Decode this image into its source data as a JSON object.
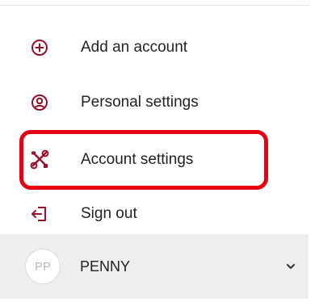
{
  "menu": {
    "items": [
      {
        "label": "Add an account",
        "icon": "add-circle-icon"
      },
      {
        "label": "Personal settings",
        "icon": "person-circle-icon"
      },
      {
        "label": "Account settings",
        "icon": "tools-icon"
      },
      {
        "label": "Sign out",
        "icon": "sign-out-icon"
      }
    ]
  },
  "account": {
    "initials": "PP",
    "name": "PENNY",
    "expand_icon": "chevron-down-icon"
  },
  "colors": {
    "highlight": "#e60012",
    "icon": "#9b0f2a",
    "account_bar": "#eeeeee"
  }
}
